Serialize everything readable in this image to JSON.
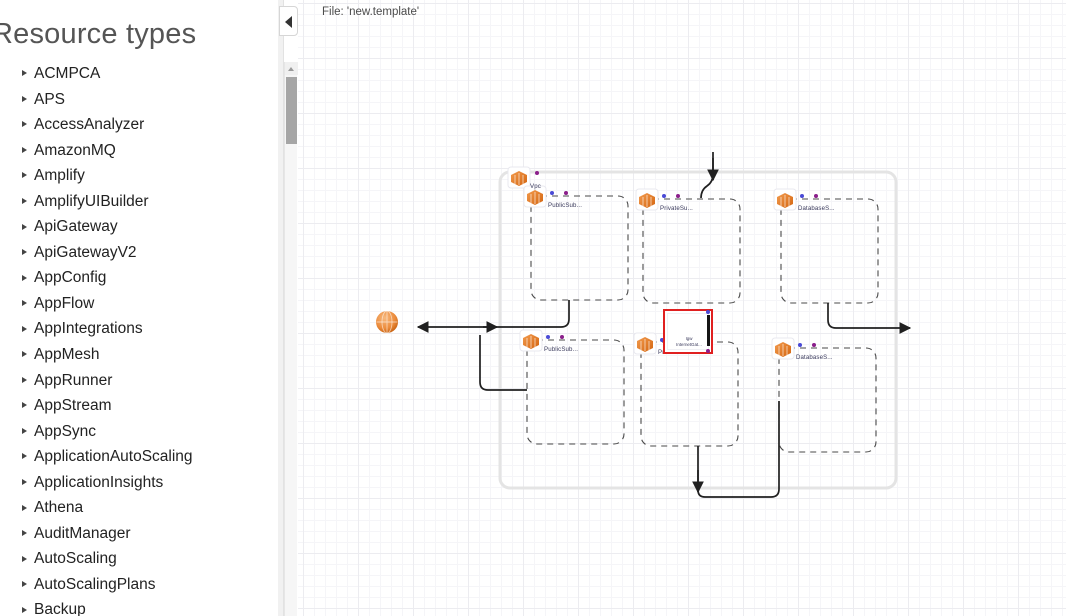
{
  "sidebar": {
    "title": "Resource types",
    "collapse_button_label": "collapse-panel",
    "items": [
      {
        "label": "ACMPCA"
      },
      {
        "label": "APS"
      },
      {
        "label": "AccessAnalyzer"
      },
      {
        "label": "AmazonMQ"
      },
      {
        "label": "Amplify"
      },
      {
        "label": "AmplifyUIBuilder"
      },
      {
        "label": "ApiGateway"
      },
      {
        "label": "ApiGatewayV2"
      },
      {
        "label": "AppConfig"
      },
      {
        "label": "AppFlow"
      },
      {
        "label": "AppIntegrations"
      },
      {
        "label": "AppMesh"
      },
      {
        "label": "AppRunner"
      },
      {
        "label": "AppStream"
      },
      {
        "label": "AppSync"
      },
      {
        "label": "ApplicationAutoScaling"
      },
      {
        "label": "ApplicationInsights"
      },
      {
        "label": "Athena"
      },
      {
        "label": "AuditManager"
      },
      {
        "label": "AutoScaling"
      },
      {
        "label": "AutoScalingPlans"
      },
      {
        "label": "Backup"
      }
    ]
  },
  "canvas": {
    "file_label": "File: 'new.template'",
    "grid_color": "#ececf0",
    "background": "#ffffff"
  },
  "diagram": {
    "vpc": {
      "label": "Vpc",
      "border_color": "#e4e4e4"
    },
    "selected_node": {
      "label_line1": "Igw",
      "label_line2": "InternetGat...",
      "selection_color": "#e02020"
    },
    "subnets": [
      {
        "label": "PublicSub...",
        "row": 1,
        "col": 1
      },
      {
        "label": "PrivateSu...",
        "row": 1,
        "col": 2
      },
      {
        "label": "DatabaseS...",
        "row": 1,
        "col": 3
      },
      {
        "label": "PublicSub...",
        "row": 2,
        "col": 1
      },
      {
        "label": "PrivateSu...",
        "row": 2,
        "col": 2
      },
      {
        "label": "DatabaseS...",
        "row": 2,
        "col": 3
      }
    ],
    "colors": {
      "icon_orange": "#e8833a",
      "icon_orange_dark": "#c25c14",
      "port_blue": "#4a4ad6",
      "port_purple": "#8b1f8b",
      "connector": "#202020",
      "subnet_border": "#4a4a4a"
    }
  }
}
